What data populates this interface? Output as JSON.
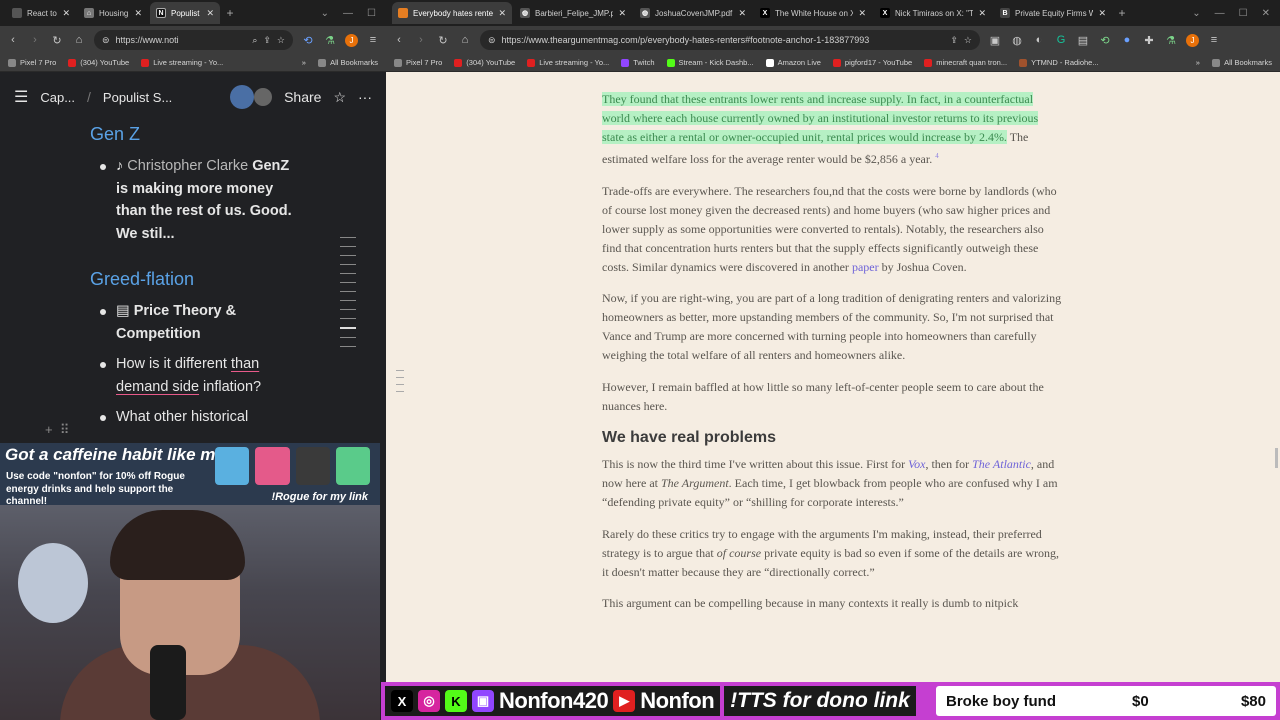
{
  "left_browser": {
    "tabs": [
      {
        "label": "React to",
        "icon": "tab-favicon",
        "color": "#444"
      },
      {
        "label": "Housing",
        "icon": "home-icon",
        "color": "#444"
      },
      {
        "label": "Populist",
        "icon": "notion-icon",
        "color": "#222",
        "active": true
      }
    ],
    "url": "https://www.noti",
    "bookmarks": [
      "Pixel 7 Pro",
      "(304) YouTube",
      "Live streaming - Yo...",
      "All Bookmarks"
    ]
  },
  "notion": {
    "breadcrumb_1": "Cap...",
    "breadcrumb_sep": "/",
    "breadcrumb_2": "Populist S...",
    "share_label": "Share",
    "heading_genz": "Gen Z",
    "item1_prefix": "Christopher Clarke",
    "item1_bold": "GenZ is making more money than the rest of us. Good. We stil...",
    "heading_greed": "Greed-flation",
    "item2": "Price Theory & Competition",
    "item3_a": "How is it different ",
    "item3_ul1": "than",
    "item3_ul2": "demand side",
    "item3_b": " inflation?",
    "item4": "What other historical"
  },
  "ad": {
    "headline": "Got a caffeine habit like me?",
    "body": "Use code \"nonfon\" for 10% off Rogue energy drinks and help support the channel!",
    "cta": "!Rogue for my link"
  },
  "right_browser": {
    "tabs": [
      {
        "label": "Everybody hates rente",
        "color": "#e67e22",
        "active": true
      },
      {
        "label": "Barbieri_Felipe_JMP.pd",
        "color": "#555"
      },
      {
        "label": "JoshuaCovenJMP.pdf",
        "color": "#555"
      },
      {
        "label": "The White House on X",
        "color": "#111"
      },
      {
        "label": "Nick Timiraos on X: \"Tr",
        "color": "#111"
      },
      {
        "label": "Private Equity Firms W",
        "color": "#444"
      }
    ],
    "url": "https://www.theargumentmag.com/p/everybody-hates-renters#footnote-anchor-1-183877993",
    "bookmarks": [
      "Pixel 7 Pro",
      "(304) YouTube",
      "Live streaming - Yo...",
      "Twitch",
      "Stream - Kick Dashb...",
      "Amazon Live",
      "pigford17 - YouTube",
      "minecraft quan tron...",
      "YTMND - Radiohe...",
      "All Bookmarks"
    ]
  },
  "article": {
    "p1_highlight": "They found that these entrants lower rents and increase supply. In fact, in a counterfactual world where each house currently owned by an institutional investor returns to its previous state as either a rental or owner-occupied unit, rental prices would increase by 2.4%.",
    "p1_rest": " The estimated welfare loss for the average renter would be $2,856 a year.",
    "p1_footnote": "4",
    "p2_a": "Trade-offs are everywhere. The researchers fou,nd that the costs were borne by landlords (who of course lost money given the decreased rents) and home buyers (who saw higher prices and lower supply as some opportunities were converted to rentals). Notably, the researchers also find that concentration hurts renters but that the supply effects significantly outweigh these costs. Similar dynamics were discovered in another ",
    "p2_link": "paper",
    "p2_b": " by Joshua Coven.",
    "p3": "Now, if you are right-wing, you are part of a long tradition of denigrating renters and valorizing homeowners as better, more upstanding members of the community. So, I'm not surprised that Vance and Trump are more concerned with turning people into homeowners than carefully weighing the total welfare of all renters and homeowners alike.",
    "p4": "However, I remain baffled at how little so many left-of-center people seem to care about the nuances here.",
    "h2": "We have real problems",
    "p5_a": "This is now the third time I've written about this issue. First for ",
    "p5_vox": "Vox",
    "p5_b": ", then for ",
    "p5_atl": "The Atlantic",
    "p5_c": ", and now here at ",
    "p5_arg": "The Argument",
    "p5_d": ". Each time, I get blowback from people who are confused why I am “defending private equity” or “shilling for corporate interests.”",
    "p6_a": "Rarely do these critics try to engage with the arguments I'm making, instead, their preferred strategy is to argue that ",
    "p6_em": "of course",
    "p6_b": " private equity is bad so even if some of the details are wrong, it doesn't matter because they are “directionally correct.”",
    "p7": "This argument can be compelling because in many contexts it really is dumb to nitpick"
  },
  "stream_bar": {
    "handle": "Nonfon420",
    "youtube_name": "Nonfon",
    "tts": "!TTS for dono link",
    "fund_label": "Broke boy fund",
    "fund_current": "$0",
    "fund_goal": "$80"
  }
}
